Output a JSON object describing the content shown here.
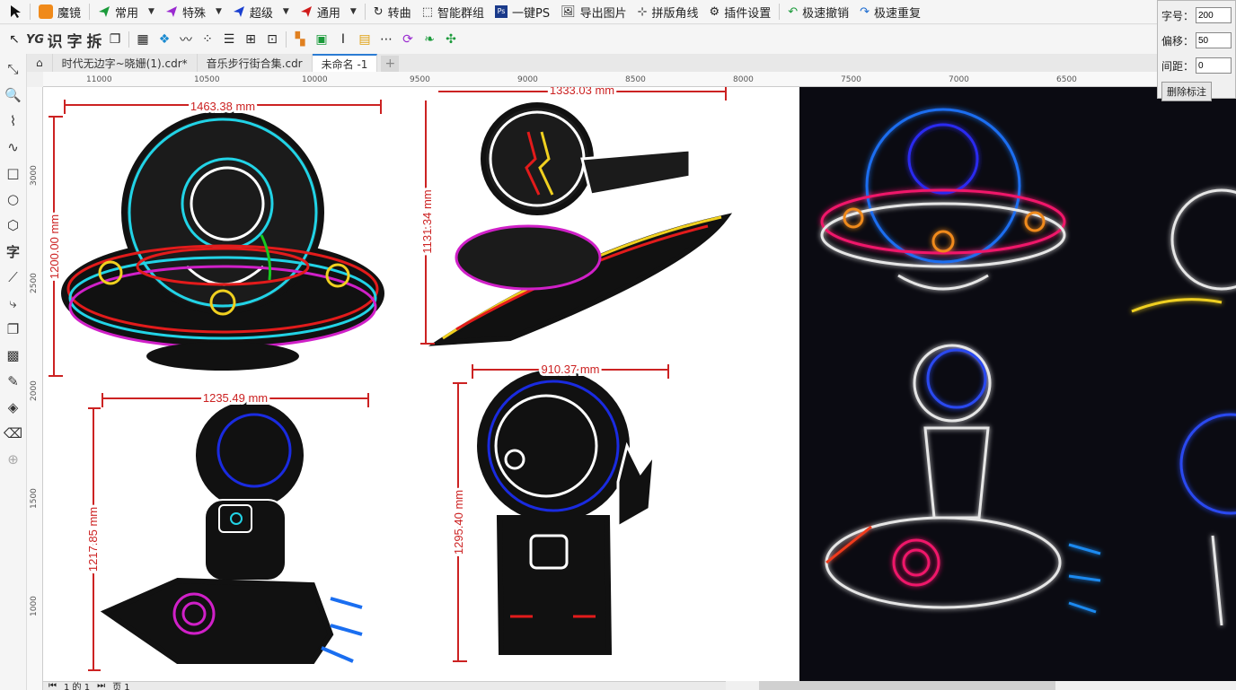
{
  "toolbar1": {
    "items": [
      {
        "label": "魔镜",
        "icon": "mirror-icon"
      },
      {
        "label": "常用",
        "icon": "paper-plane-icon",
        "dropdown": true
      },
      {
        "label": "特殊",
        "icon": "paper-plane-icon",
        "dropdown": true
      },
      {
        "label": "超级",
        "icon": "paper-plane-icon",
        "dropdown": true
      },
      {
        "label": "通用",
        "icon": "paper-plane-icon",
        "dropdown": true
      },
      {
        "label": "转曲",
        "icon": "curve-icon"
      },
      {
        "label": "智能群组",
        "icon": "group-icon"
      },
      {
        "label": "一键PS",
        "icon": "ps-icon"
      },
      {
        "label": "导出图片",
        "icon": "image-icon"
      },
      {
        "label": "拼版角线",
        "icon": "crop-marks-icon"
      },
      {
        "label": "插件设置",
        "icon": "gear-icon"
      },
      {
        "label": "极速撤销",
        "icon": "undo-icon"
      },
      {
        "label": "极速重复",
        "icon": "redo-icon"
      }
    ]
  },
  "toolbar2": {
    "glyphs": [
      "YG",
      "识",
      "字",
      "拆"
    ]
  },
  "tabs": [
    {
      "label": "时代无边字~晓姗(1).cdr*",
      "active": false
    },
    {
      "label": "音乐步行街合集.cdr",
      "active": false
    },
    {
      "label": "未命名 -1",
      "active": true
    }
  ],
  "ruler": {
    "h_ticks": [
      "11000",
      "10500",
      "10000",
      "9500",
      "9000",
      "8500",
      "8000",
      "7500",
      "7000",
      "6500"
    ],
    "v_ticks": [
      "3000",
      "2500",
      "2000",
      "1500",
      "1000"
    ]
  },
  "panel": {
    "rows": [
      {
        "label": "字号：",
        "value": "200"
      },
      {
        "label": "偏移：",
        "value": "50"
      },
      {
        "label": "间距：",
        "value": "0"
      }
    ],
    "button": "删除标注"
  },
  "dimensions": {
    "ufo_width": "1463.38 mm",
    "ufo_height": "1200.00 mm",
    "surf_width": "1333.03 mm",
    "surf_height": "1131.34 mm",
    "rocket_width": "1235.49 mm",
    "rocket_height": "1217.85 mm",
    "peace_width": "910.37 mm",
    "peace_height": "1295.40 mm"
  },
  "statusbar": {
    "page_counter": "1 的 1",
    "page_tab": "页 1"
  },
  "colors": {
    "dimension": "#cc2222",
    "neon_cyan": "#22d3e6",
    "neon_red": "#e21b1b",
    "neon_magenta": "#d020c8",
    "neon_yellow": "#f0d020",
    "neon_blue": "#1a2be0",
    "neon_green": "#18c820"
  }
}
